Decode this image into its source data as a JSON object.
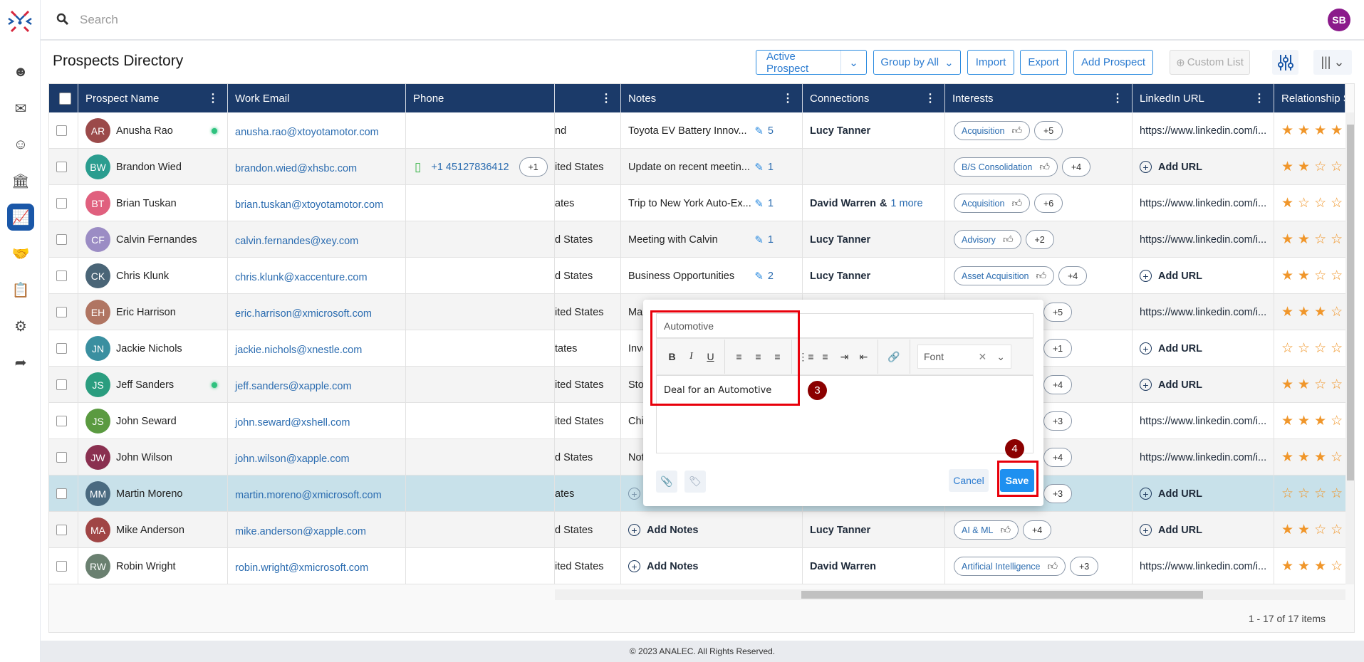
{
  "app": {
    "search_placeholder": "Search",
    "user_initials": "SB",
    "footer": "© 2023 ANALEC. All Rights Reserved."
  },
  "sidebar": {
    "items": [
      {
        "icon": "user-check-icon"
      },
      {
        "icon": "mail-icon"
      },
      {
        "icon": "user-icon"
      },
      {
        "icon": "bank-icon"
      },
      {
        "icon": "analytics-icon",
        "active": true
      },
      {
        "icon": "handshake-icon"
      },
      {
        "icon": "clipboard-icon"
      },
      {
        "icon": "user-settings-icon"
      },
      {
        "icon": "user-share-icon"
      }
    ]
  },
  "header": {
    "title": "Prospects Directory",
    "active_prospect": "Active Prospect",
    "group_by": "Group by All",
    "import": "Import",
    "export": "Export",
    "add_prospect": "Add Prospect",
    "custom_list": "Custom List"
  },
  "columns": [
    "Prospect Name",
    "Work Email",
    "Phone",
    "",
    "Notes",
    "Connections",
    "Interests",
    "LinkedIn URL",
    "Relationship S"
  ],
  "rows": [
    {
      "initials": "AR",
      "name": "Anusha Rao",
      "color": "#9b4a4a",
      "online": true,
      "email": "anusha.rao@xtoyotamotor.com",
      "phone": "",
      "phone_more": "",
      "country": "nd",
      "notes": "Toyota EV Battery Innov...",
      "notes_count": "5",
      "connection": "Lucy Tanner",
      "more": "",
      "interest": "Acquisition",
      "interest_more": "+5",
      "linkedin": "https://www.linkedin.com/i...",
      "rating": 4
    },
    {
      "initials": "BW",
      "name": "Brandon Wied",
      "color": "#2a9d8f",
      "email": "brandon.wied@xhsbc.com",
      "phone": "+1 45127836412",
      "phone_more": "+1",
      "country": "ited States",
      "notes": "Update on recent meetin...",
      "notes_count": "1",
      "connection": "",
      "more": "",
      "interest": "B/S Consolidation",
      "interest_more": "+4",
      "linkedin": "Add URL",
      "rating": 2
    },
    {
      "initials": "BT",
      "name": "Brian Tuskan",
      "color": "#e0607e",
      "email": "brian.tuskan@xtoyotamotor.com",
      "phone": "",
      "country": "ates",
      "notes": "Trip to New York Auto-Ex...",
      "notes_count": "1",
      "connection": "David Warren",
      "more": "1 more",
      "interest": "Acquisition",
      "interest_more": "+6",
      "linkedin": "https://www.linkedin.com/i...",
      "rating": 1
    },
    {
      "initials": "CF",
      "name": "Calvin Fernandes",
      "color": "#9b8cc4",
      "email": "calvin.fernandes@xey.com",
      "phone": "",
      "country": "d States",
      "notes": "Meeting with Calvin",
      "notes_count": "1",
      "connection": "Lucy Tanner",
      "more": "",
      "interest": "Advisory",
      "interest_more": "+2",
      "linkedin": "https://www.linkedin.com/i...",
      "rating": 2
    },
    {
      "initials": "CK",
      "name": "Chris Klunk",
      "color": "#4a6577",
      "email": "chris.klunk@xaccenture.com",
      "phone": "",
      "country": "d States",
      "notes": "Business Opportunities",
      "notes_count": "2",
      "connection": "Lucy Tanner",
      "more": "",
      "interest": "Asset Acquisition",
      "interest_more": "+4",
      "linkedin": "Add URL",
      "rating": 2
    },
    {
      "initials": "EH",
      "name": "Eric Harrison",
      "color": "#b07562",
      "email": "eric.harrison@xmicrosoft.com",
      "phone": "",
      "country": "ited States",
      "notes": "Mar",
      "connection": "",
      "interest": "",
      "interest_more": "+5",
      "linkedin": "https://www.linkedin.com/i...",
      "rating": 3
    },
    {
      "initials": "JN",
      "name": "Jackie Nichols",
      "color": "#3a8fa0",
      "email": "jackie.nichols@xnestle.com",
      "phone": "",
      "country": "tates",
      "notes": "Inve",
      "connection": "",
      "interest": "",
      "interest_more": "+1",
      "linkedin": "Add URL",
      "rating": 0
    },
    {
      "initials": "JS",
      "name": "Jeff Sanders",
      "color": "#2a9d7f",
      "online": true,
      "email": "jeff.sanders@xapple.com",
      "phone": "",
      "country": "ited States",
      "notes": "Stoc",
      "connection": "",
      "interest": "",
      "interest_more": "+4",
      "linkedin": "Add URL",
      "rating": 2
    },
    {
      "initials": "JS",
      "name": "John Seward",
      "color": "#5a9a40",
      "email": "john.seward@xshell.com",
      "phone": "",
      "country": "ited States",
      "notes": "Chir",
      "connection": "",
      "interest": "",
      "interest_more": "+3",
      "linkedin": "https://www.linkedin.com/i...",
      "rating": 3
    },
    {
      "initials": "JW",
      "name": "John Wilson",
      "color": "#8a3050",
      "email": "john.wilson@xapple.com",
      "phone": "",
      "country": "d States",
      "notes": "Note",
      "connection": "",
      "interest": "",
      "interest_more": "+4",
      "linkedin": "https://www.linkedin.com/i...",
      "rating": 3
    },
    {
      "initials": "MM",
      "name": "Martin Moreno",
      "color": "#4a6a80",
      "selected": true,
      "email": "martin.moreno@xmicrosoft.com",
      "phone": "",
      "country": "ates",
      "notes": "",
      "add_notes_icon": true,
      "connection": "",
      "interest": "",
      "interest_more": "+3",
      "linkedin": "Add URL",
      "rating": 0
    },
    {
      "initials": "MA",
      "name": "Mike Anderson",
      "color": "#a04545",
      "email": "mike.anderson@xapple.com",
      "phone": "",
      "country": "d States",
      "notes": "Add Notes",
      "add_notes": true,
      "connection": "Lucy Tanner",
      "more": "",
      "interest": "AI & ML",
      "interest_more": "+4",
      "linkedin": "Add URL",
      "rating": 2
    },
    {
      "initials": "RW",
      "name": "Robin Wright",
      "color": "#6a8070",
      "email": "robin.wright@xmicrosoft.com",
      "phone": "",
      "country": "ited States",
      "notes": "Add Notes",
      "add_notes": true,
      "connection": "David Warren",
      "more": "",
      "interest": "Artificial Intelligence",
      "interest_more": "+3",
      "linkedin": "https://www.linkedin.com/i...",
      "rating": 3
    }
  ],
  "pager": "1 - 17 of 17 items",
  "modal": {
    "title_value": "Automotive",
    "font_placeholder": "Font",
    "body": "Deal for an Automotive",
    "cancel": "Cancel",
    "save": "Save",
    "step3": "3",
    "step4": "4"
  },
  "colors": {
    "header": "#1b3a69",
    "accent": "#1e90f0",
    "star": "#f0962a",
    "highlight": "#c8e1ea",
    "annotation": "#e8000b"
  }
}
